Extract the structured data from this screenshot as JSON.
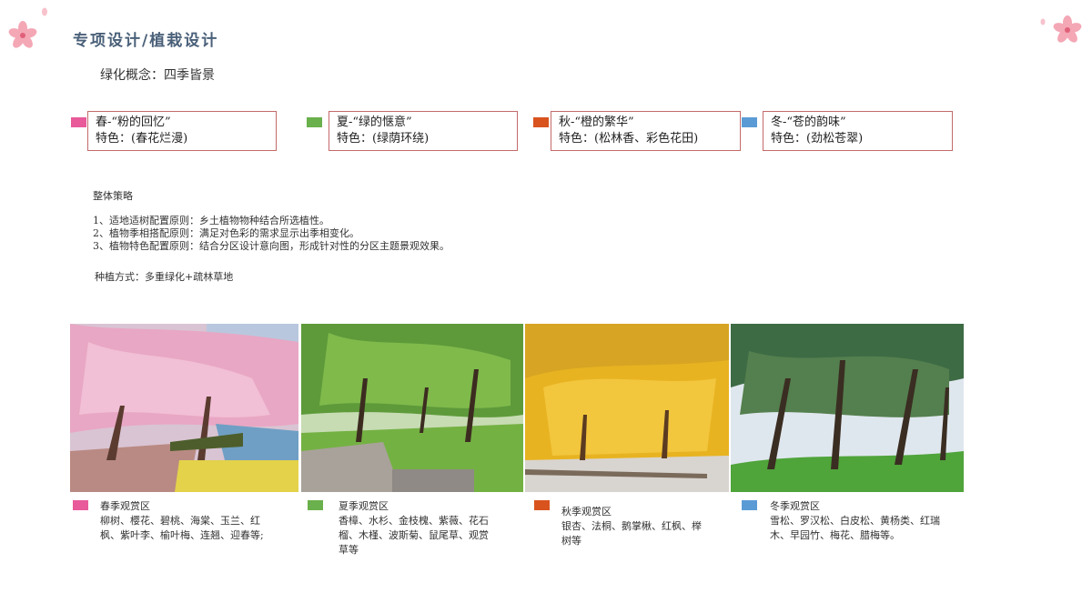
{
  "header": {
    "title": "专项设计/植栽设计"
  },
  "concept": "绿化概念：四季皆景",
  "seasons": [
    {
      "name": "春-“粉的回忆”",
      "feature": "特色：(春花烂漫)",
      "color": "#e85a9a"
    },
    {
      "name": "夏-“绿的惬意”",
      "feature": "特色：(绿荫环绕)",
      "color": "#6ab04c"
    },
    {
      "name": "秋-“橙的繁华”",
      "feature": "特色：(松林香、彩色花田)",
      "color": "#d9531e"
    },
    {
      "name": "冬-“苍的韵味”",
      "feature": "特色：(劲松苍翠)",
      "color": "#5b9bd5"
    }
  ],
  "strategy": {
    "heading": "整体策略",
    "items": [
      "1、适地适树配置原则：乡土植物物种结合所选植性。",
      "2、植物季相搭配原则：满足对色彩的需求显示出季相变化。",
      "3、植物特色配置原则：结合分区设计意向图，形成针对性的分区主题景观效果。"
    ]
  },
  "planting": "种植方式：多重绿化+疏林草地",
  "zones": [
    {
      "title": "春季观赏区",
      "line1": "柳树、樱花、碧桃、海棠、玉兰、红",
      "line2": "枫、紫叶李、榆叶梅、连翘、迎春等;",
      "line3": ""
    },
    {
      "title": "夏季观赏区",
      "line1": "香樟、水杉、金枝槐、紫薇、花石",
      "line2": "榴、木槿、波斯菊、鼠尾草、观赏",
      "line3": "草等"
    },
    {
      "title": "秋季观赏区",
      "line1": "银杏、法桐、鹅掌楸、红枫、榉",
      "line2": "树等",
      "line3": ""
    },
    {
      "title": "冬季观赏区",
      "line1": "雪松、罗汉松、白皮松、黄杨类、红瑞",
      "line2": "木、早园竹、梅花、腊梅等。",
      "line3": ""
    }
  ]
}
